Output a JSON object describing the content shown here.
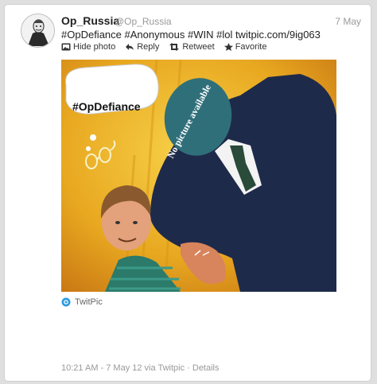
{
  "tweet": {
    "display_name": "Op_Russia",
    "handle": "@Op_Russia",
    "date": "7 May",
    "text": "#OpDefiance #Anonymous #WIN #lol twitpic.com/9ig063",
    "actions": {
      "hide_photo": "Hide photo",
      "reply": "Reply",
      "retweet": "Retweet",
      "favorite": "Favorite"
    },
    "photo": {
      "speech_bubble": "#OpDefiance",
      "face_overlay": "No picture available"
    },
    "source_name": "TwitPic",
    "footer": {
      "timestamp": "10:21 AM - 7 May 12 via Twitpic",
      "separator": " · ",
      "details": "Details"
    }
  },
  "colors": {
    "comic_background": "#e8a820",
    "suit": "#1e2a4a",
    "overlay": "#2f6f7a",
    "twitpic_blue": "#2b9be0"
  }
}
